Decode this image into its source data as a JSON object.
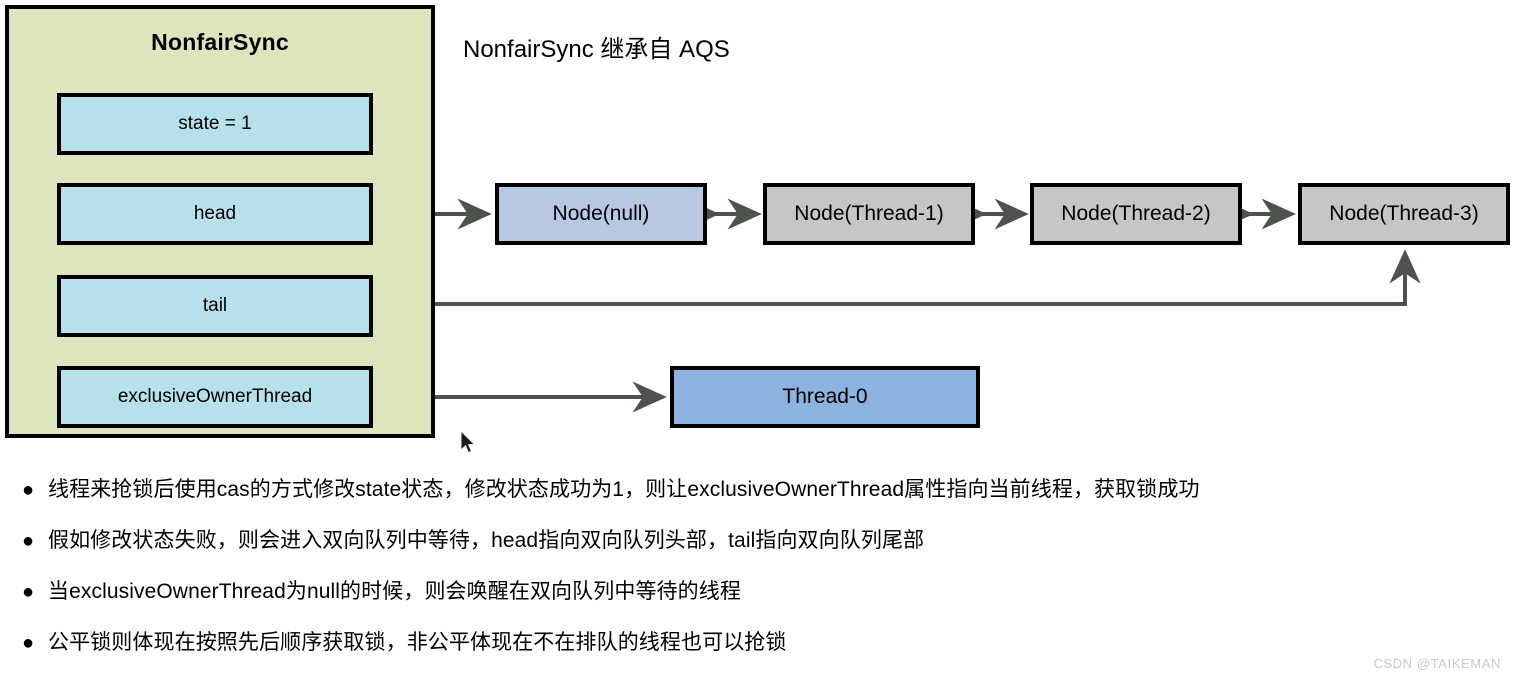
{
  "diagram": {
    "sync_panel": {
      "title": "NonfairSync",
      "fields": [
        {
          "label": "state = 1"
        },
        {
          "label": "head"
        },
        {
          "label": "tail"
        },
        {
          "label": "exclusiveOwnerThread"
        }
      ]
    },
    "caption": "NonfairSync 继承自 AQS",
    "queue_nodes": [
      {
        "label": "Node(null)"
      },
      {
        "label": "Node(Thread-1)"
      },
      {
        "label": "Node(Thread-2)"
      },
      {
        "label": "Node(Thread-3)"
      }
    ],
    "owner_thread": {
      "label": "Thread-0"
    },
    "colors": {
      "panel_fill": "#dde5bd",
      "field_fill": "#b6e0ea",
      "head_node_fill": "#b8c8e2",
      "wait_node_fill": "#c6c6c6",
      "owner_thread_fill": "#8cb3e0",
      "border": "#000000",
      "wire": "#4d524d"
    }
  },
  "notes": {
    "bullet_glyph": "●",
    "items": [
      "线程来抢锁后使用cas的方式修改state状态，修改状态成功为1，则让exclusiveOwnerThread属性指向当前线程，获取锁成功",
      "假如修改状态失败，则会进入双向队列中等待，head指向双向队列头部，tail指向双向队列尾部",
      "当exclusiveOwnerThread为null的时候，则会唤醒在双向队列中等待的线程",
      "公平锁则体现在按照先后顺序获取锁，非公平体现在不在排队的线程也可以抢锁"
    ]
  },
  "watermark": "CSDN @TAIKEMAN"
}
